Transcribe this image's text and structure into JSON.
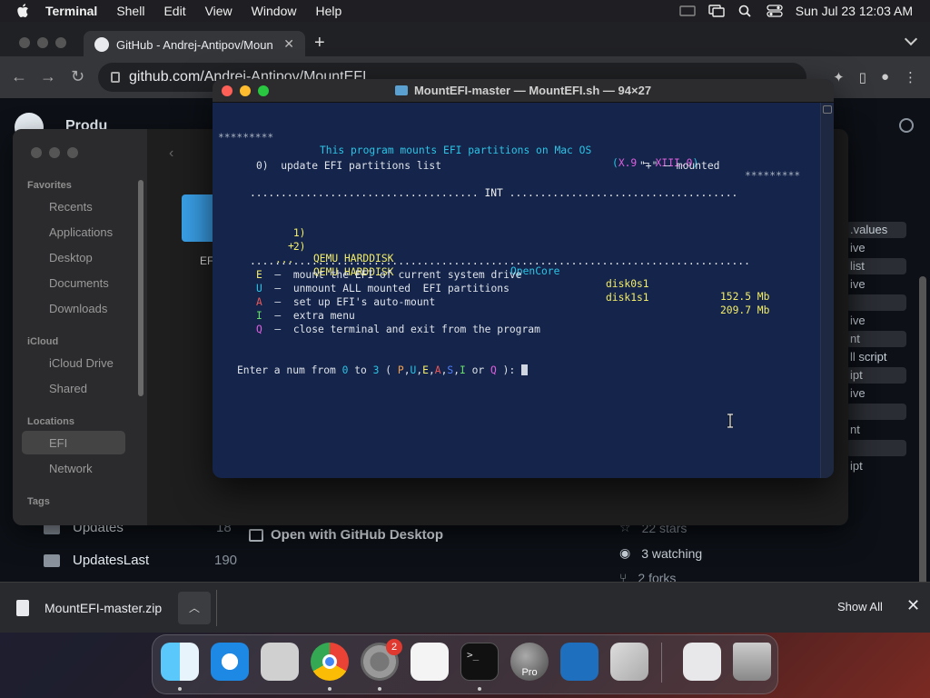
{
  "menubar": {
    "app": "Terminal",
    "items": [
      "Shell",
      "Edit",
      "View",
      "Window",
      "Help"
    ],
    "clock": "Sun Jul 23  12:03 AM"
  },
  "browser": {
    "tab_title": "GitHub - Andrej-Antipov/Moun",
    "url": "github.com/Andrej-Antipov/MountEFI",
    "page": {
      "nav_label": "Produ",
      "rows": [
        {
          "name": "Updates",
          "meta": "18"
        },
        {
          "name": "UpdatesLast",
          "meta": "190"
        }
      ],
      "open_with": "Open with GitHub Desktop",
      "stats": [
        "22 stars",
        "3 watching",
        "2 forks"
      ],
      "side_items": [
        ".values",
        "ive",
        "list",
        "ive",
        "",
        "ive",
        "nt",
        "ll script",
        "ipt",
        "ive",
        "",
        "nt",
        "",
        "ipt"
      ]
    }
  },
  "download": {
    "file": "MountEFI-master.zip",
    "show_all": "Show All"
  },
  "finder": {
    "sections": [
      {
        "title": "Favorites",
        "items": [
          "Recents",
          "Applications",
          "Desktop",
          "Documents",
          "Downloads"
        ]
      },
      {
        "title": "iCloud",
        "items": [
          "iCloud Drive",
          "Shared"
        ]
      },
      {
        "title": "Locations",
        "items": [
          "EFI",
          "Network"
        ]
      },
      {
        "title": "Tags",
        "items": []
      }
    ],
    "folder_label": "EFI"
  },
  "terminal": {
    "title": "MountEFI-master — MountEFI.sh — 94×27",
    "header": {
      "stars": "*********",
      "text": "This program mounts EFI partitions on Mac OS",
      "range_open": "(",
      "range_a": "X.9",
      "range_dash": " – ",
      "range_b": "XIII.0",
      "range_close": ")"
    },
    "option0": "0)  update EFI partitions list",
    "mounted_hint": "\"+\" – mounted",
    "int_line": "..................................... INT .....................................",
    "partitions": [
      {
        "num": "1)",
        "mark": "+",
        "name": "QEMU HARDDISK",
        "loader": "OpenCore",
        "disk": "disk0s1",
        "size": "152.5 Mb"
      },
      {
        "num": "2)",
        "mark": "...",
        "name": "QEMU HARDDISK",
        "loader": "",
        "disk": "disk1s1",
        "size": "209.7 Mb"
      }
    ],
    "sep_line": ".................................................................................",
    "commands": [
      {
        "key": "E",
        "text": "mount the EFI of current system drive"
      },
      {
        "key": "U",
        "text": "unmount ALL mounted  EFI partitions"
      },
      {
        "key": "A",
        "text": "set up EFI's auto-mount"
      },
      {
        "key": "I",
        "text": "extra menu"
      },
      {
        "key": "Q",
        "text": "close terminal and exit from the program"
      }
    ],
    "prompt": {
      "p1": "Enter a num from ",
      "n0": "0",
      "p2": " to ",
      "n3": "3",
      "p3": " ( ",
      "k": [
        "P",
        "U",
        "E",
        "A",
        "S",
        "I"
      ],
      "p4": " or ",
      "q": "Q",
      "p5": " ): "
    }
  },
  "dock": {
    "apps": [
      "Finder",
      "Safari",
      "Preview",
      "Chrome",
      "System Settings",
      "TextEdit",
      "Terminal",
      "Google Earth Pro",
      "VS Code",
      "Launchpad",
      "Downloads",
      "Trash"
    ],
    "settings_badge": "2",
    "earth_label": "Pro",
    "terminal_label": ">_"
  },
  "colors": {
    "terminal_bg": "#14244a",
    "cyan": "#2cc4e6",
    "yellow": "#f4ee6a",
    "red": "#ec5a5a",
    "green": "#68e06a",
    "pink": "#e060e0"
  }
}
